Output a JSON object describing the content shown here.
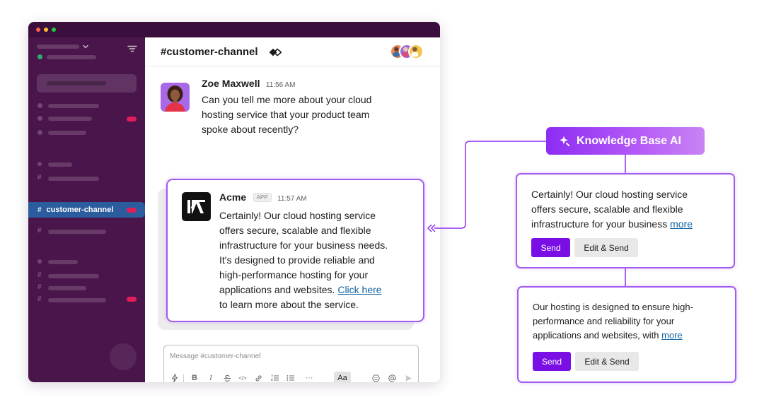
{
  "window": {
    "controls": [
      "close",
      "minimize",
      "maximize"
    ]
  },
  "sidebar": {
    "active_channel": {
      "label": "customer-channel",
      "prefix": "#"
    },
    "hash_symbol": "#",
    "colors": {
      "background": "#4a154b",
      "active": "#2b5d9e",
      "badge": "#e01e5a"
    }
  },
  "channel": {
    "title": "#customer-channel",
    "icon": "diamond-link-icon"
  },
  "messages": [
    {
      "author": "Zoe Maxwell",
      "time": "11:56 AM",
      "lines": [
        "Can you tell me more about your cloud",
        "hosting service that your product team",
        "spoke about recently?"
      ]
    },
    {
      "author": "Acme",
      "badge": "APP",
      "time": "11:57 AM",
      "lines": [
        "Certainly! Our cloud hosting service",
        "offers secure, scalable and flexible",
        "infrastructure for your business needs.",
        "It's designed to provide reliable and",
        "high-performance hosting for your"
      ],
      "line6_text": "applications and websites. ",
      "link": "Click here",
      "line7": "to learn more about the service."
    }
  ],
  "composer": {
    "placeholder": "Message #customer-channel",
    "value": "",
    "toolbar": {
      "bold": "B",
      "italic": "I",
      "code": "</>",
      "more": "···",
      "format": "Aa",
      "icons": [
        "lightning-icon",
        "strikethrough-icon",
        "link-icon",
        "ordered-list-icon",
        "bullet-list-icon",
        "emoji-icon",
        "mention-icon",
        "send-icon"
      ]
    }
  },
  "kb": {
    "title": "Knowledge Base AI",
    "accent": "#7a0fe5",
    "suggestions": [
      {
        "lines": [
          "Certainly! Our cloud hosting service",
          "offers secure, scalable and flexible"
        ],
        "last_line": "infrastructure for your business ",
        "more": "more",
        "send": "Send",
        "edit": "Edit & Send"
      },
      {
        "lines": [
          "Our hosting is designed to ensure high-",
          "performance and reliability for your"
        ],
        "last_line": "applications and websites, with ",
        "more": "more",
        "send": "Send",
        "edit": "Edit & Send"
      }
    ]
  }
}
